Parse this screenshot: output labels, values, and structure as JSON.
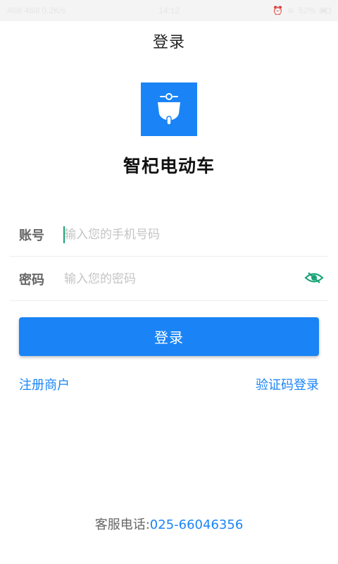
{
  "status_bar": {
    "left": "46ill 46ill 0.2K/s",
    "time": "14:12",
    "battery": "52%"
  },
  "header": {
    "title": "登录"
  },
  "brand": {
    "app_name": "智杞电动车",
    "logo_color": "#1a84f6"
  },
  "form": {
    "account": {
      "label": "账号",
      "placeholder": "输入您的手机号码",
      "value": ""
    },
    "password": {
      "label": "密码",
      "placeholder": "输入您的密码",
      "value": ""
    },
    "login_label": "登录"
  },
  "links": {
    "register": "注册商户",
    "code_login": "验证码登录"
  },
  "footer": {
    "label": "客服电话:",
    "phone": "025-66046356"
  },
  "colors": {
    "accent": "#1a84f6",
    "eye_icon": "#1aa377"
  }
}
